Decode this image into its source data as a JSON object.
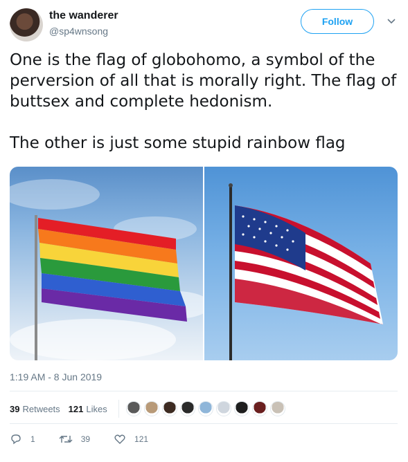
{
  "user": {
    "name": "the wanderer",
    "handle": "@sp4wnsong",
    "avatar_icon": "avatar-image"
  },
  "follow_label": "Follow",
  "menu_icon": "chevron-down-icon",
  "tweet": {
    "paragraphs": [
      "One is the flag of globohomo, a symbol of the perversion of all that is morally right. The flag of buttsex and complete hedonism.",
      "The other is just some stupid rainbow flag"
    ]
  },
  "media": {
    "left_photo": "rainbow-flag-photo",
    "right_photo": "us-flag-photo"
  },
  "timestamp": "1:19 AM - 8 Jun 2019",
  "stats": {
    "retweets_count": "39",
    "retweets_label": "Retweets",
    "likes_count": "121",
    "likes_label": "Likes",
    "liker_avatar_colors": [
      "#5a5a5a",
      "#b89a78",
      "#3d2b22",
      "#2a2a2a",
      "#8fb6d9",
      "#cfd6de",
      "#1e1e1e",
      "#6a1f1f",
      "#c9c1b6"
    ]
  },
  "actions": {
    "reply_count": "1",
    "retweet_count": "39",
    "like_count": "121"
  },
  "colors": {
    "accent": "#1da1f2",
    "secondary_text": "#657786"
  }
}
